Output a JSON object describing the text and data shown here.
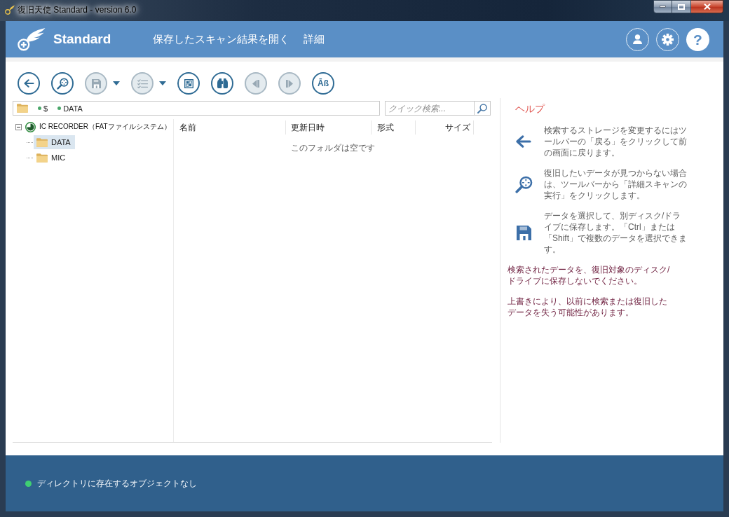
{
  "window": {
    "title": "復旧天使 Standard - version 6.0"
  },
  "header": {
    "product": "Standard",
    "menu": [
      {
        "label": "保存したスキャン結果を開く"
      },
      {
        "label": "詳細"
      }
    ],
    "help_glyph": "?"
  },
  "toolbar": [
    {
      "kind": "back",
      "disabled": false,
      "dropdown": false
    },
    {
      "kind": "scan",
      "disabled": false,
      "dropdown": false
    },
    {
      "kind": "save",
      "disabled": true,
      "dropdown": true
    },
    {
      "kind": "select",
      "disabled": true,
      "dropdown": true
    },
    {
      "kind": "view",
      "disabled": false,
      "dropdown": false
    },
    {
      "kind": "find",
      "disabled": false,
      "dropdown": false
    },
    {
      "kind": "previous",
      "disabled": true,
      "dropdown": false
    },
    {
      "kind": "next",
      "disabled": true,
      "dropdown": false
    },
    {
      "kind": "text",
      "disabled": false,
      "dropdown": false,
      "glyph": "Āß"
    }
  ],
  "path_bar": {
    "segments": [
      "$",
      "DATA"
    ]
  },
  "search": {
    "placeholder": "クイック検索..."
  },
  "tree": [
    {
      "label": "IC RECORDER（FATファイルシステム）",
      "expanded": true,
      "selected": false,
      "children": [
        {
          "label": "DATA",
          "selected": true
        },
        {
          "label": "MIC",
          "selected": false
        }
      ]
    }
  ],
  "file_list": {
    "columns": [
      "名前",
      "更新日時",
      "形式",
      "サイズ"
    ],
    "empty_message": "このフォルダは空です"
  },
  "help": {
    "title": "ヘルプ",
    "items": [
      {
        "kind": "back",
        "text": "検索するストレージを変更するにはツールバーの「戻る」をクリックして前の画面に戻ります。"
      },
      {
        "kind": "scan",
        "text": "復旧したいデータが見つからない場合は、ツールバーから「詳細スキャンの実行」をクリックします。"
      },
      {
        "kind": "save",
        "text": "データを選択して、別ディスク/ドライブに保存します。「Ctrl」または「Shift」で複数のデータを選択できます。"
      }
    ],
    "warnings": [
      "検索されたデータを、復旧対象のディスク/ドライブに保存しないでください。",
      "上書きにより、以前に検索または復旧したデータを失う可能性があります。"
    ]
  },
  "status_bar": {
    "text": "ディレクトリに存在するオブジェクトなし"
  }
}
